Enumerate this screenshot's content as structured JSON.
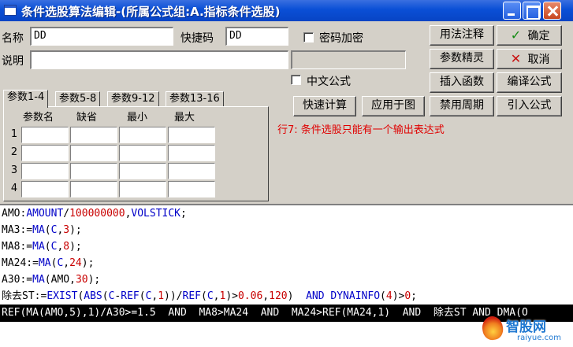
{
  "window": {
    "title": "条件选股算法编辑-(所属公式组:A.指标条件选股)"
  },
  "form": {
    "name_label": "名称",
    "name_value": "DD",
    "shortcut_label": "快捷码",
    "shortcut_value": "DD",
    "password_label": "密码加密",
    "desc_label": "说明",
    "desc_value": "",
    "chinese_formula_label": "中文公式"
  },
  "buttons": {
    "usage_notes": "用法注释",
    "param_wizard": "参数精灵",
    "insert_function": "插入函数",
    "quick_calc": "快速计算",
    "apply_to_chart": "应用于图",
    "disable_period": "禁用周期",
    "ok": "确定",
    "cancel": "取消",
    "compile": "编译公式",
    "import": "引入公式"
  },
  "tabs": [
    "参数1-4",
    "参数5-8",
    "参数9-12",
    "参数13-16"
  ],
  "params": {
    "headers": [
      "参数名",
      "缺省",
      "最小",
      "最大"
    ],
    "rows": [
      "1",
      "2",
      "3",
      "4"
    ]
  },
  "status_message": "行7: 条件选股只能有一个输出表达式",
  "editor": {
    "lines": [
      [
        {
          "t": "AMO:"
        },
        {
          "t": "AMOUNT",
          "c": "kw"
        },
        {
          "t": "/"
        },
        {
          "t": "100000000",
          "c": "num"
        },
        {
          "t": ","
        },
        {
          "t": "VOLSTICK",
          "c": "kw"
        },
        {
          "t": ";"
        }
      ],
      [
        {
          "t": "MA3:="
        },
        {
          "t": "MA",
          "c": "kw"
        },
        {
          "t": "("
        },
        {
          "t": "C",
          "c": "kw"
        },
        {
          "t": ","
        },
        {
          "t": "3",
          "c": "num"
        },
        {
          "t": ");"
        }
      ],
      [
        {
          "t": "MA8:="
        },
        {
          "t": "MA",
          "c": "kw"
        },
        {
          "t": "("
        },
        {
          "t": "C",
          "c": "kw"
        },
        {
          "t": ","
        },
        {
          "t": "8",
          "c": "num"
        },
        {
          "t": ");"
        }
      ],
      [
        {
          "t": "MA24:="
        },
        {
          "t": "MA",
          "c": "kw"
        },
        {
          "t": "("
        },
        {
          "t": "C",
          "c": "kw"
        },
        {
          "t": ","
        },
        {
          "t": "24",
          "c": "num"
        },
        {
          "t": ");"
        }
      ],
      [
        {
          "t": "A30:="
        },
        {
          "t": "MA",
          "c": "kw"
        },
        {
          "t": "(AMO,"
        },
        {
          "t": "30",
          "c": "num"
        },
        {
          "t": ");"
        }
      ],
      [
        {
          "t": "除去ST:="
        },
        {
          "t": "EXIST",
          "c": "kw"
        },
        {
          "t": "("
        },
        {
          "t": "ABS",
          "c": "kw"
        },
        {
          "t": "("
        },
        {
          "t": "C",
          "c": "kw"
        },
        {
          "t": "-"
        },
        {
          "t": "REF",
          "c": "kw"
        },
        {
          "t": "("
        },
        {
          "t": "C",
          "c": "kw"
        },
        {
          "t": ","
        },
        {
          "t": "1",
          "c": "num"
        },
        {
          "t": "))/"
        },
        {
          "t": "REF",
          "c": "kw"
        },
        {
          "t": "("
        },
        {
          "t": "C",
          "c": "kw"
        },
        {
          "t": ","
        },
        {
          "t": "1",
          "c": "num"
        },
        {
          "t": ")>"
        },
        {
          "t": "0.06",
          "c": "num"
        },
        {
          "t": ","
        },
        {
          "t": "120",
          "c": "num"
        },
        {
          "t": ")  "
        },
        {
          "t": "AND",
          "c": "kw"
        },
        {
          "t": " "
        },
        {
          "t": "DYNAINFO",
          "c": "kw"
        },
        {
          "t": "("
        },
        {
          "t": "4",
          "c": "num"
        },
        {
          "t": ")>"
        },
        {
          "t": "0",
          "c": "num"
        },
        {
          "t": ";"
        }
      ],
      [
        {
          "t": "REF(MA(AMO,5),1)/A30>=1.5  AND  MA8>MA24  AND  MA24>REF(MA24,1)  AND  除去ST AND DMA(O"
        }
      ]
    ],
    "selected_line": 6
  },
  "watermark": {
    "brand": "智股网",
    "url": "raiyue.com"
  }
}
